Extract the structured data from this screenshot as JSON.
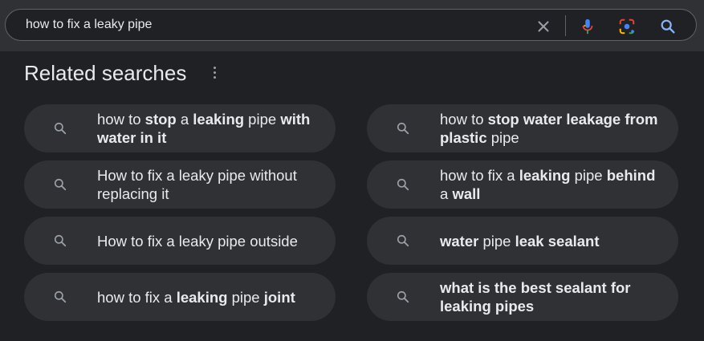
{
  "search": {
    "query": "how to fix a leaky pipe",
    "icons": [
      "close-icon",
      "microphone-icon",
      "google-lens-icon",
      "search-icon"
    ]
  },
  "related": {
    "heading": "Related searches",
    "items": [
      {
        "segments": [
          {
            "t": "how to ",
            "b": false
          },
          {
            "t": "stop",
            "b": true
          },
          {
            "t": " a ",
            "b": false
          },
          {
            "t": "leaking",
            "b": true
          },
          {
            "t": " pipe ",
            "b": false
          },
          {
            "t": "with water in it",
            "b": true
          }
        ]
      },
      {
        "segments": [
          {
            "t": "how to ",
            "b": false
          },
          {
            "t": "stop water leakage from plastic",
            "b": true
          },
          {
            "t": " pipe",
            "b": false
          }
        ]
      },
      {
        "segments": [
          {
            "t": "How to fix a leaky pipe without replacing it",
            "b": false
          }
        ]
      },
      {
        "segments": [
          {
            "t": "how to fix a ",
            "b": false
          },
          {
            "t": "leaking",
            "b": true
          },
          {
            "t": " pipe ",
            "b": false
          },
          {
            "t": "behind",
            "b": true
          },
          {
            "t": " a ",
            "b": false
          },
          {
            "t": "wall",
            "b": true
          }
        ]
      },
      {
        "segments": [
          {
            "t": "How to fix a leaky pipe outside",
            "b": false
          }
        ]
      },
      {
        "segments": [
          {
            "t": "water",
            "b": true
          },
          {
            "t": " pipe ",
            "b": false
          },
          {
            "t": "leak sealant",
            "b": true
          }
        ]
      },
      {
        "segments": [
          {
            "t": "how to fix a ",
            "b": false
          },
          {
            "t": "leaking",
            "b": true
          },
          {
            "t": " pipe ",
            "b": false
          },
          {
            "t": "joint",
            "b": true
          }
        ]
      },
      {
        "segments": [
          {
            "t": "what is the best sealant for leaking pipes",
            "b": true
          }
        ]
      }
    ]
  }
}
